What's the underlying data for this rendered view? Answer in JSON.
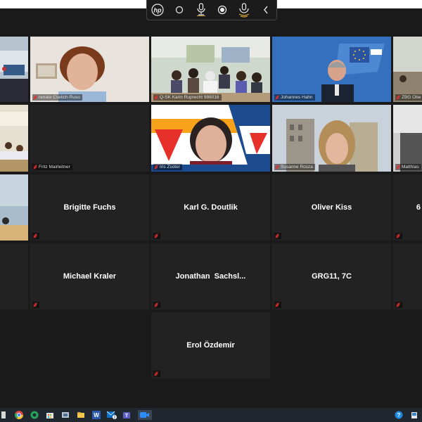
{
  "toolbar": {
    "logo": "hp",
    "buttons": [
      "camera-icon",
      "mic-icon",
      "record-icon",
      "voice-icon",
      "collapse-icon"
    ]
  },
  "gallery": {
    "video_tiles": [
      {
        "name": ""
      },
      {
        "name": "renate Cselich-Ruso"
      },
      {
        "name": "Q-SK Karin Ruprecht 986016"
      },
      {
        "name": "Johannes Hahn"
      },
      {
        "name": "ZBG Obe"
      },
      {
        "name": ""
      },
      {
        "name": "Fritz Mairleitner"
      },
      {
        "name": "Iris Zsoter"
      },
      {
        "name": "Susanne Rosza"
      },
      {
        "name": "Matthias"
      },
      {
        "name": ""
      }
    ],
    "named_tiles": [
      {
        "name": "Brigitte Fuchs"
      },
      {
        "name": "Karl G. Doutlik"
      },
      {
        "name": "Oliver Kiss"
      },
      {
        "name": "6"
      },
      {
        "name": "Michael Kraler"
      },
      {
        "name": "Jonathan  Sachsl..."
      },
      {
        "name": "GRG11, 7C"
      },
      {
        "name": "Erol Özdemir"
      }
    ]
  },
  "taskbar": {
    "icons": [
      "start-icon",
      "chrome-icon",
      "browser-icon",
      "store-icon",
      "snip-icon",
      "files-icon",
      "word-icon",
      "mail-icon",
      "teams-icon",
      "zoom-icon",
      "help-icon",
      "notification-icon"
    ],
    "word_label": "W",
    "mail_badge": "2"
  },
  "colors": {
    "accent_outline": "#c9e04b",
    "tile_bg": "#222222",
    "taskbar_bg": "#20272f",
    "muted_mic": "#e0302f"
  }
}
